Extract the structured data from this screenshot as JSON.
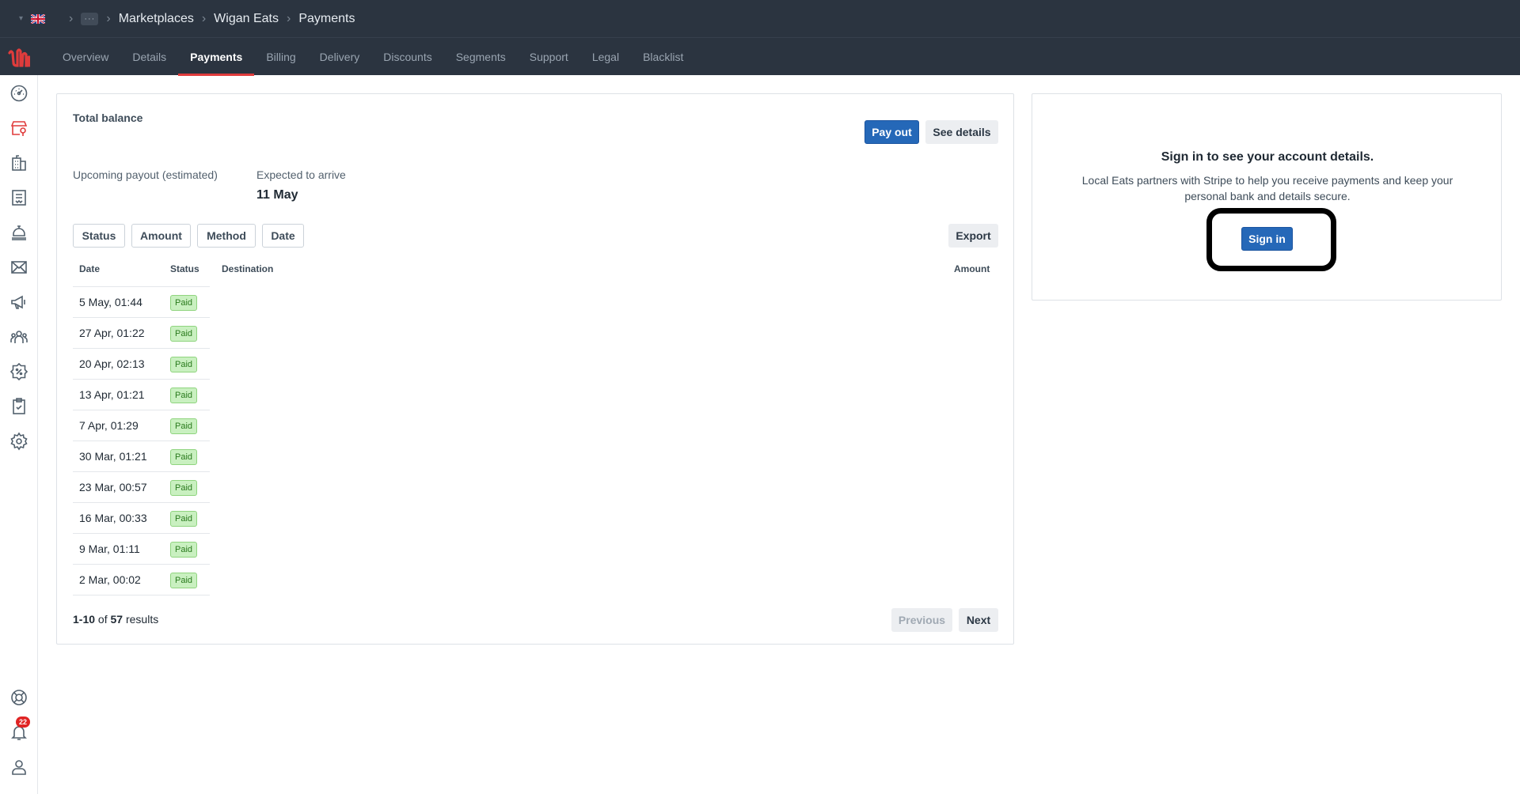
{
  "breadcrumb": {
    "items": [
      "Marketplaces",
      "Wigan Eats",
      "Payments"
    ],
    "more": "···"
  },
  "nav": {
    "tabs": [
      "Overview",
      "Details",
      "Payments",
      "Billing",
      "Delivery",
      "Discounts",
      "Segments",
      "Support",
      "Legal",
      "Blacklist"
    ],
    "active": "Payments"
  },
  "sidebar": {
    "icons": [
      "dashboard-icon",
      "store-location-icon",
      "building-icon",
      "receipt-icon",
      "service-bell-icon",
      "mail-icon",
      "megaphone-icon",
      "team-icon",
      "discount-badge-icon",
      "clipboard-check-icon",
      "settings-icon"
    ],
    "bottom_icons": [
      "help-lifebuoy-icon",
      "notifications-bell-icon",
      "user-profile-icon"
    ],
    "notification_count": "22"
  },
  "balance": {
    "title": "Total balance",
    "pay_out": "Pay out",
    "see_details": "See details",
    "upcoming_label": "Upcoming payout (estimated)",
    "expected_label": "Expected to arrive",
    "expected_value": "11 May"
  },
  "filters": {
    "status": "Status",
    "amount": "Amount",
    "method": "Method",
    "date": "Date",
    "export": "Export"
  },
  "table": {
    "headers": {
      "date": "Date",
      "status": "Status",
      "destination": "Destination",
      "amount": "Amount"
    },
    "rows": [
      {
        "date": "5 May, 01:44",
        "status": "Paid"
      },
      {
        "date": "27 Apr, 01:22",
        "status": "Paid"
      },
      {
        "date": "20 Apr, 02:13",
        "status": "Paid"
      },
      {
        "date": "13 Apr, 01:21",
        "status": "Paid"
      },
      {
        "date": "7 Apr, 01:29",
        "status": "Paid"
      },
      {
        "date": "30 Mar, 01:21",
        "status": "Paid"
      },
      {
        "date": "23 Mar, 00:57",
        "status": "Paid"
      },
      {
        "date": "16 Mar, 00:33",
        "status": "Paid"
      },
      {
        "date": "9 Mar, 01:11",
        "status": "Paid"
      },
      {
        "date": "2 Mar, 00:02",
        "status": "Paid"
      }
    ]
  },
  "pagination": {
    "range": "1-10",
    "of": "of",
    "total": "57",
    "results": "results",
    "previous": "Previous",
    "next": "Next"
  },
  "stripe": {
    "title": "Sign in to see your account details.",
    "description": "Local Eats partners with Stripe to help you receive payments and keep your personal bank and details secure.",
    "sign_in": "Sign in"
  },
  "colors": {
    "header_bg": "#2b3440",
    "accent_red": "#e03c3c",
    "primary_blue": "#2568b8",
    "paid_green": "#c9f0c0"
  }
}
